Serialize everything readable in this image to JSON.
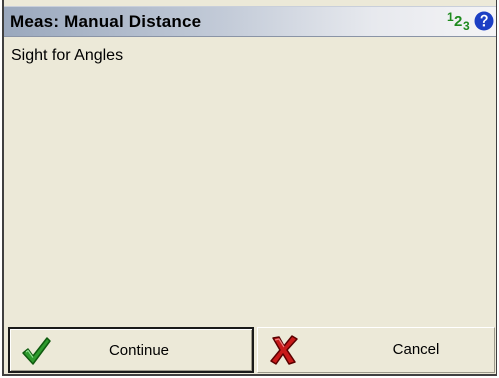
{
  "window": {
    "title": "Meas: Manual Distance",
    "numeric_mode_icon": "numeric-123-icon",
    "help_icon": "help-question-icon"
  },
  "numeric_icon_digits": [
    "1",
    "2",
    "3"
  ],
  "main": {
    "message": "Sight for Angles"
  },
  "buttons": {
    "continue": {
      "label": "Continue",
      "icon": "green-checkmark-icon"
    },
    "cancel": {
      "label": "Cancel",
      "icon": "red-x-icon"
    }
  },
  "colors": {
    "background": "#ece9d8",
    "title_gradient_start": "#9aa8bd",
    "numeric_icon": "#1e8a1e",
    "help_icon": "#1c3fc4",
    "check": "#2e9a2e",
    "cross": "#c81a1a"
  }
}
